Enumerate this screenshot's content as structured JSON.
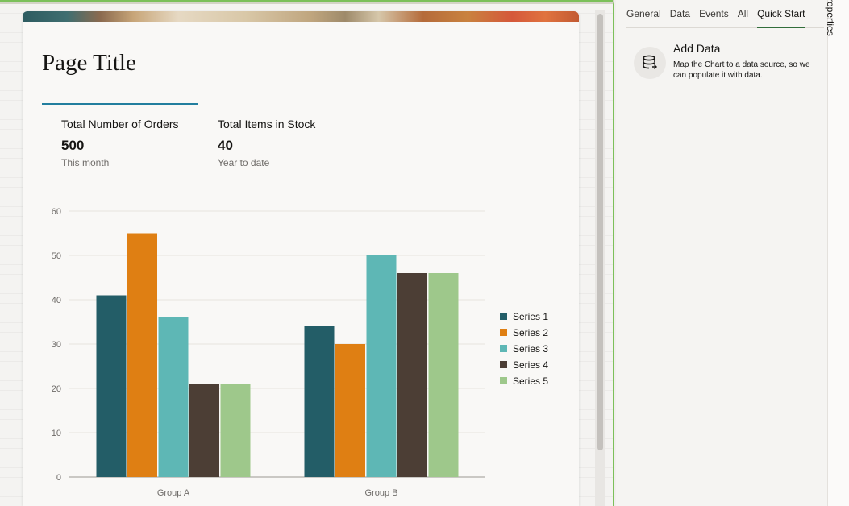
{
  "page": {
    "title": "Page Title",
    "metrics": [
      {
        "label": "Total Number of Orders",
        "value": "500",
        "sub": "This month"
      },
      {
        "label": "Total Items in Stock",
        "value": "40",
        "sub": "Year to date"
      }
    ]
  },
  "chart_data": {
    "type": "bar",
    "categories": [
      "Group A",
      "Group B"
    ],
    "series": [
      {
        "name": "Series 1",
        "values": [
          41,
          34
        ],
        "color": "#235d67"
      },
      {
        "name": "Series 2",
        "values": [
          55,
          30
        ],
        "color": "#df7f13"
      },
      {
        "name": "Series 3",
        "values": [
          36,
          50
        ],
        "color": "#5eb7b5"
      },
      {
        "name": "Series 4",
        "values": [
          21,
          46
        ],
        "color": "#4c3e35"
      },
      {
        "name": "Series 5",
        "values": [
          21,
          46
        ],
        "color": "#9ec88b"
      }
    ],
    "ylim": [
      0,
      60
    ],
    "yticks": [
      0,
      10,
      20,
      30,
      40,
      50,
      60
    ],
    "grid": true,
    "legend": "right"
  },
  "properties_panel": {
    "tabs": [
      "General",
      "Data",
      "Events",
      "All",
      "Quick Start"
    ],
    "active_tab": "Quick Start",
    "quick_start": {
      "icon": "database-icon",
      "title": "Add Data",
      "description": "Map the Chart to a data source, so we can populate it with data."
    },
    "side_tab_label": "Properties"
  },
  "colors": {
    "accent_underline": "#227e9e",
    "active_tab_underline": "#316d3a",
    "selection_border": "#7cc05a"
  }
}
